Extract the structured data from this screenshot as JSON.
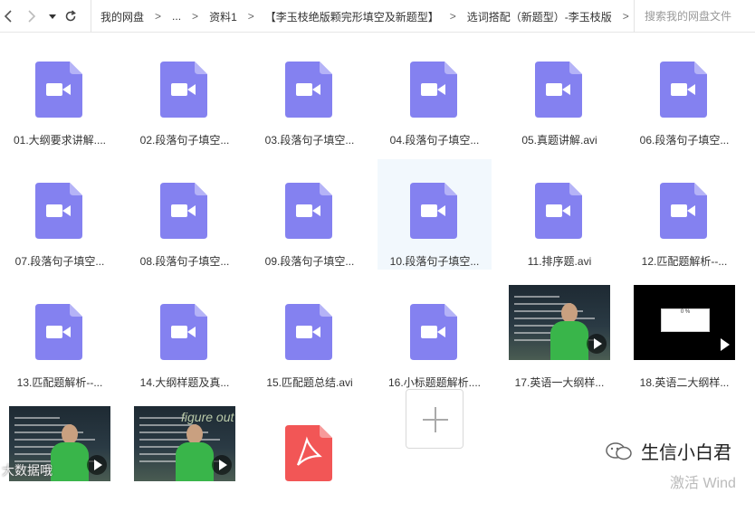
{
  "toolbar": {
    "breadcrumbs": [
      "我的网盘",
      "...",
      "资料1",
      "【李玉枝绝版颗完形填空及新题型】",
      "选词搭配（新题型）-李玉枝版"
    ],
    "separator": ">",
    "search_placeholder": "搜索我的网盘文件",
    "icons": [
      "back-arrow-icon",
      "forward-arrow-icon",
      "dropdown-arrow-icon",
      "refresh-icon"
    ]
  },
  "files": [
    {
      "name": "01.大纲要求讲解....",
      "type": "video"
    },
    {
      "name": "02.段落句子填空...",
      "type": "video"
    },
    {
      "name": "03.段落句子填空...",
      "type": "video"
    },
    {
      "name": "04.段落句子填空...",
      "type": "video"
    },
    {
      "name": "05.真题讲解.avi",
      "type": "video"
    },
    {
      "name": "06.段落句子填空...",
      "type": "video"
    },
    {
      "name": "07.段落句子填空...",
      "type": "video"
    },
    {
      "name": "08.段落句子填空...",
      "type": "video"
    },
    {
      "name": "09.段落句子填空...",
      "type": "video"
    },
    {
      "name": "10.段落句子填空...",
      "type": "video",
      "selected": true
    },
    {
      "name": "11.排序题.avi",
      "type": "video"
    },
    {
      "name": "12.匹配题解析--...",
      "type": "video"
    },
    {
      "name": "13.匹配题解析--...",
      "type": "video"
    },
    {
      "name": "14.大纲样题及真...",
      "type": "video"
    },
    {
      "name": "15.匹配题总结.avi",
      "type": "video"
    },
    {
      "name": "16.小标题题解析....",
      "type": "video"
    },
    {
      "name": "17.英语一大纲样...",
      "type": "thumbnail-lecture"
    },
    {
      "name": "18.英语二大纲样...",
      "type": "thumbnail-loading",
      "loading_text": "0 %"
    },
    {
      "name": "",
      "type": "thumbnail-lecture"
    },
    {
      "name": "",
      "type": "thumbnail-lecture-chalk",
      "chalk_text": "figure out"
    },
    {
      "name": "",
      "type": "pdf"
    }
  ],
  "add_tile_icon": "plus-icon",
  "overlays": {
    "watermark": "生信小白君",
    "activate": "激活 Wind",
    "thumb_watermark": "大数据哦"
  },
  "colors": {
    "video_icon": "#8481f0",
    "video_icon_fold": "#b5b3f7",
    "pdf_icon": "#f25656",
    "selected_bg": "#f2f8fd"
  }
}
